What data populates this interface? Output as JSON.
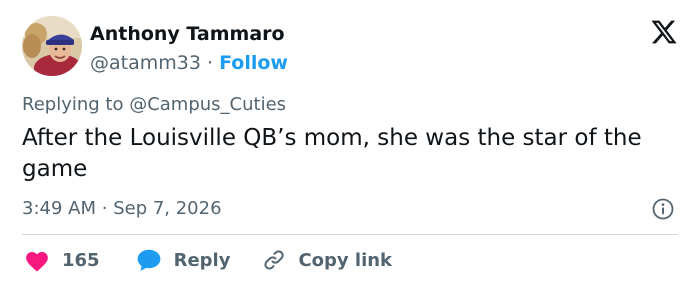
{
  "author": {
    "name": "Anthony Tammaro",
    "handle": "@atamm33",
    "separator": "·",
    "follow_label": "Follow"
  },
  "replying_to": "Replying to @Campus_Cuties",
  "tweet": {
    "text": "After the Louisville QB’s mom, she was the star of the game",
    "time": "3:49 AM",
    "separator": "·",
    "date": "Sep 7, 2026"
  },
  "actions": {
    "like_count": "165",
    "reply_label": "Reply",
    "copy_link_label": "Copy link"
  },
  "icons": {
    "logo": "x-logo-icon",
    "info": "info-icon",
    "like": "heart-icon",
    "reply": "speech-bubble-icon",
    "copy": "link-icon"
  },
  "colors": {
    "accent": "#1d9bf0",
    "like": "#f91880",
    "text": "#0f1419",
    "muted": "#536471",
    "divider": "#cfd9de"
  }
}
